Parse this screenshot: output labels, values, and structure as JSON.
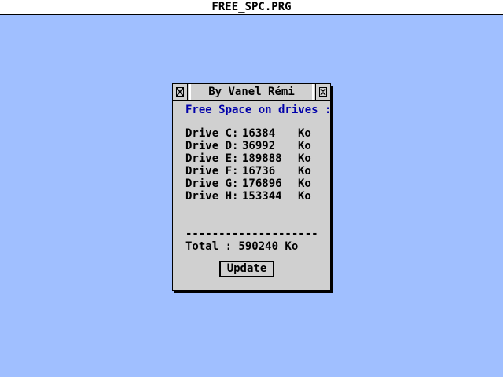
{
  "app": {
    "program_name": "FREE_SPC.PRG"
  },
  "window": {
    "title": "By Vanel Rémi",
    "heading": "Free Space on drives :",
    "drives": [
      {
        "label": "Drive C:",
        "value": "16384",
        "unit": "Ko"
      },
      {
        "label": "Drive D:",
        "value": "36992",
        "unit": "Ko"
      },
      {
        "label": "Drive E:",
        "value": "189888",
        "unit": "Ko"
      },
      {
        "label": "Drive F:",
        "value": "16736",
        "unit": "Ko"
      },
      {
        "label": "Drive G:",
        "value": "176896",
        "unit": "Ko"
      },
      {
        "label": "Drive H:",
        "value": "153344",
        "unit": "Ko"
      }
    ],
    "separator": "--------------------",
    "total": "Total : 590240 Ko",
    "update_label": "Update"
  },
  "colors": {
    "desktop": "#a0bfff",
    "window": "#d0d0d0",
    "heading": "#0000aa"
  },
  "icons": {
    "close": "close-icon",
    "fuller": "fuller-icon"
  }
}
